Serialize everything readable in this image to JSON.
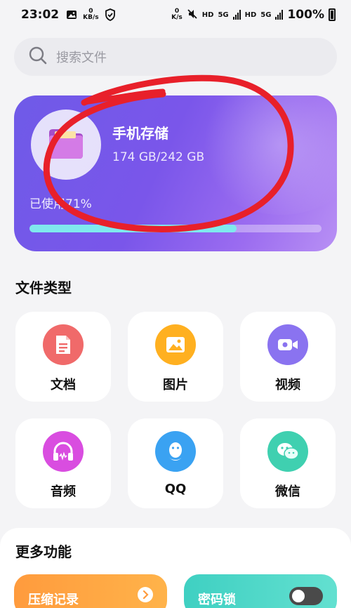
{
  "status_bar": {
    "time": "23:02",
    "speed_left_value": "0",
    "speed_left_unit": "KB/s",
    "speed_right_value": "0",
    "speed_right_unit": "K/s",
    "hd1": "HD",
    "net1": "5G",
    "hd2": "HD",
    "net2": "5G",
    "battery": "100%"
  },
  "search": {
    "placeholder": "搜索文件"
  },
  "storage": {
    "title": "手机存储",
    "size": "174 GB/242 GB",
    "used_label": "已使用71%",
    "used_fraction": 0.71
  },
  "file_types": {
    "title": "文件类型",
    "items": [
      {
        "label": "文档",
        "icon": "document-icon",
        "color": "#f06a6a"
      },
      {
        "label": "图片",
        "icon": "image-icon",
        "color": "#ffb020"
      },
      {
        "label": "视频",
        "icon": "video-icon",
        "color": "#8a73f0"
      },
      {
        "label": "音频",
        "icon": "headphones-icon",
        "color": "#d94de0"
      },
      {
        "label": "QQ",
        "icon": "qq-icon",
        "color": "#3aa2f2"
      },
      {
        "label": "微信",
        "icon": "wechat-icon",
        "color": "#3fd0b0"
      }
    ]
  },
  "more": {
    "title": "更多功能",
    "zip_label": "压缩记录",
    "lock_label": "密码锁"
  },
  "colors": {
    "accent": "#7a56ea",
    "annotation": "#e8202a"
  }
}
